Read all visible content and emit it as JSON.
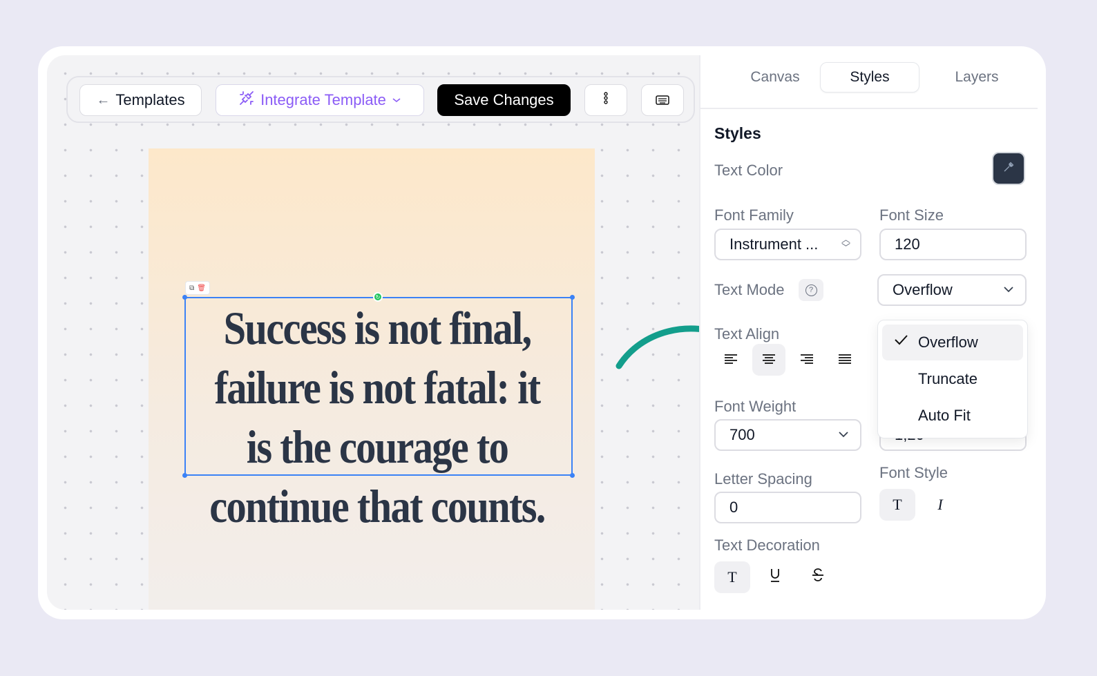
{
  "toolbar": {
    "back_label": "Templates",
    "integrate_label": "Integrate Template",
    "save_label": "Save Changes"
  },
  "canvas": {
    "quote_text": "Success is not final, failure is not fatal: it is the courage to continue that counts."
  },
  "panel": {
    "tabs": [
      {
        "label": "Canvas"
      },
      {
        "label": "Styles"
      },
      {
        "label": "Layers"
      }
    ],
    "section_title": "Styles",
    "text_color_label": "Text Color",
    "text_color_value": "#2b3546",
    "font_family_label": "Font Family",
    "font_family_value": "Instrument ...",
    "font_size_label": "Font Size",
    "font_size_value": "120",
    "text_mode_label": "Text Mode",
    "text_mode_value": "Overflow",
    "text_mode_options": [
      "Overflow",
      "Truncate",
      "Auto Fit"
    ],
    "text_align_label": "Text Align",
    "font_weight_label": "Font Weight",
    "font_weight_value": "700",
    "line_height_value": "1,20",
    "letter_spacing_label": "Letter Spacing",
    "letter_spacing_value": "0",
    "font_style_label": "Font Style",
    "text_decoration_label": "Text Decoration"
  },
  "colors": {
    "accent_teal": "#139e8c",
    "integrate_purple": "#8b5cf6",
    "selection_blue": "#3b82f6"
  }
}
